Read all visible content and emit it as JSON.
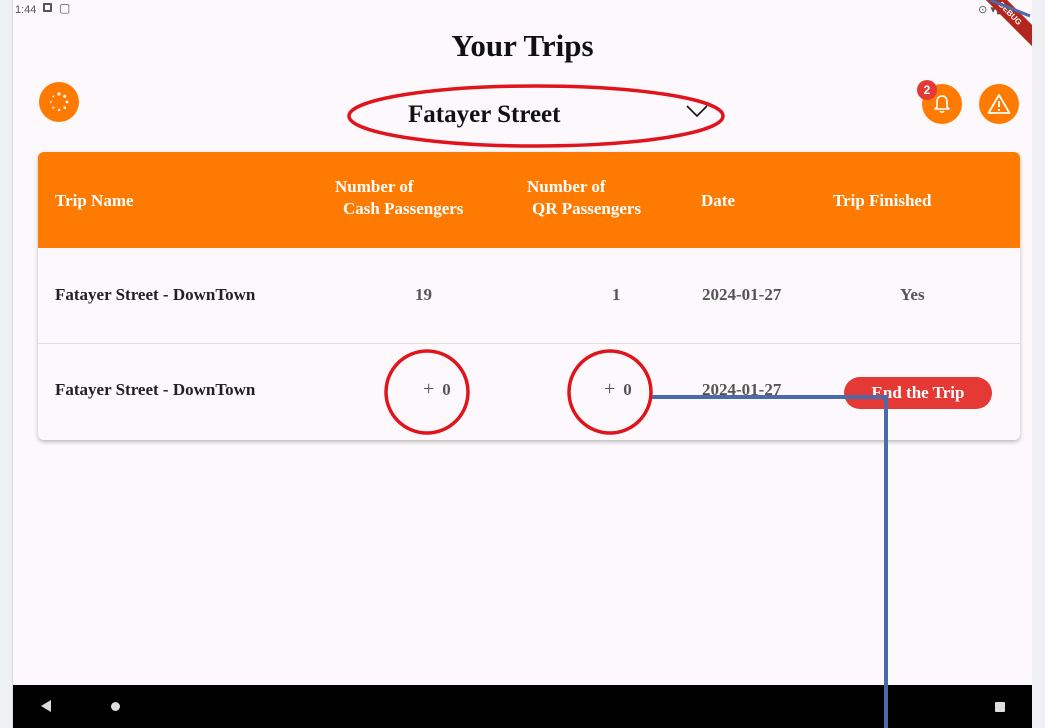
{
  "status_bar": {
    "time": "1:44"
  },
  "debug_banner": "DEBUG",
  "title": "Your Trips",
  "route_select": {
    "value": "Fatayer Street"
  },
  "notifications": {
    "badge_count": "2"
  },
  "table": {
    "headers": {
      "trip_name": "Trip Name",
      "cash_line1": "Number of",
      "cash_line2": "Cash Passengers",
      "qr_line1": "Number of",
      "qr_line2": "QR Passengers",
      "date": "Date",
      "finished": "Trip Finished"
    },
    "rows": [
      {
        "trip_name": "Fatayer Street - DownTown",
        "cash": "19",
        "qr": "1",
        "date": "2024-01-27",
        "finished": "Yes"
      },
      {
        "trip_name": "Fatayer Street - DownTown",
        "cash_plus": "+",
        "cash": "0",
        "qr_plus": "+",
        "qr": "0",
        "date": "2024-01-27",
        "action": "End the Trip"
      }
    ]
  },
  "colors": {
    "accent": "#ff7a00",
    "danger": "#e53935",
    "annotation_red": "#e0151b",
    "annotation_blue": "#4a6aa8"
  },
  "icons": [
    "loading-icon",
    "bell-icon",
    "warning-icon",
    "chevron-down-icon",
    "nav-back-icon",
    "nav-home-icon",
    "nav-recent-icon"
  ]
}
